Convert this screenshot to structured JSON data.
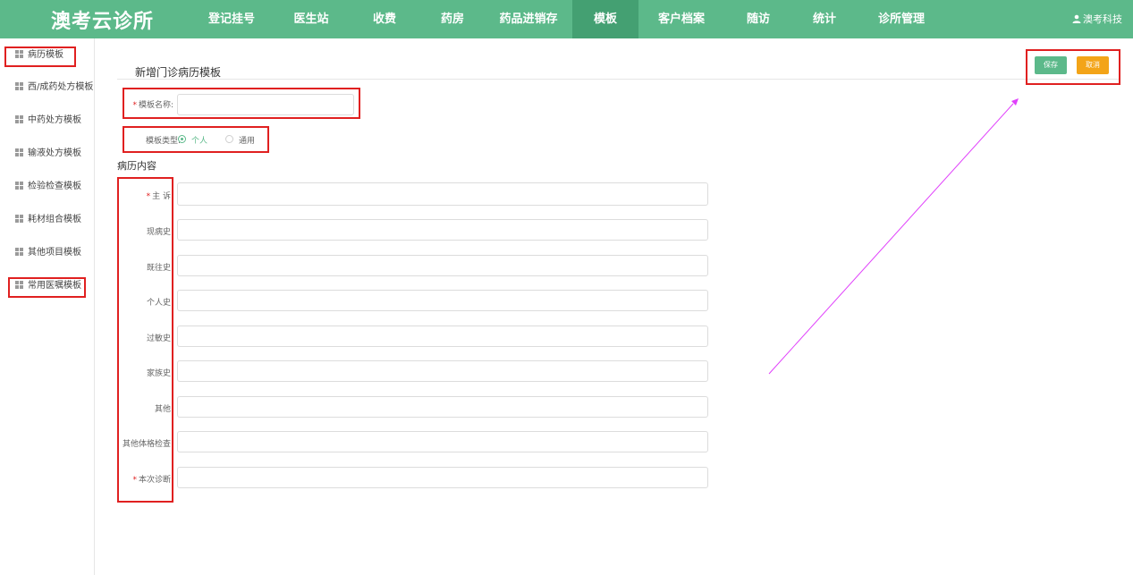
{
  "app": {
    "brand": "澳考云诊所",
    "user": "澳考科技"
  },
  "nav": {
    "items": [
      "登记挂号",
      "医生站",
      "收费",
      "药房",
      "药品进销存",
      "模板",
      "客户档案",
      "随访",
      "统计",
      "诊所管理"
    ],
    "active": "模板"
  },
  "sidebar": {
    "items": [
      "病历模板",
      "西/成药处方模板",
      "中药处方模板",
      "输液处方模板",
      "检验检查模板",
      "耗材组合模板",
      "其他项目模板",
      "常用医嘱模板"
    ]
  },
  "form": {
    "title": "新增门诊病历模板",
    "name_label": "模板名称:",
    "type_label": "模板类型:",
    "type_options": [
      "个人",
      "通用"
    ],
    "type_selected": "个人",
    "section_title": "病历内容",
    "fields": [
      "主 诉:",
      "现病史:",
      "既往史:",
      "个人史:",
      "过敏史:",
      "家族史:",
      "其他:",
      "其他体格检查:",
      "本次诊断:"
    ],
    "required_mark": "*"
  },
  "actions": {
    "save_label": "保存",
    "cancel_label": "取消"
  },
  "colors": {
    "primary": "#5cb98a",
    "active_nav": "#44a072",
    "warning": "#f3a418",
    "highlight": "#e02020",
    "arrow": "#e040fb"
  }
}
